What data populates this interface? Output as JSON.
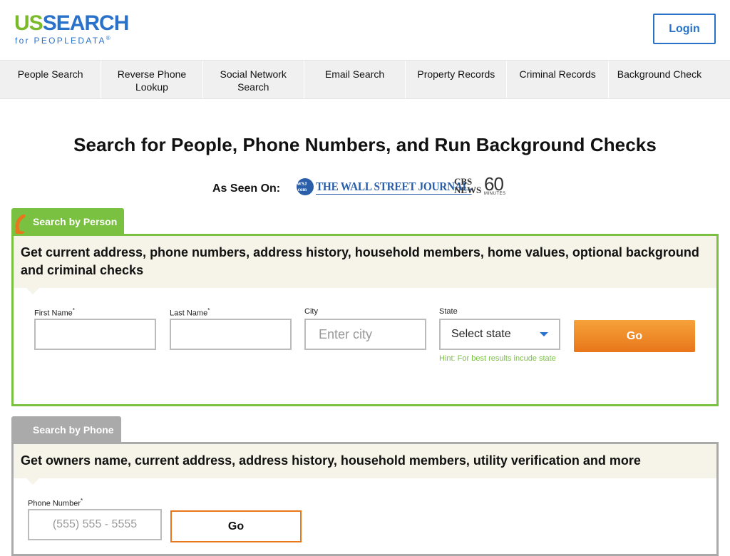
{
  "header": {
    "logo_us": "US",
    "logo_search": "SEARCH",
    "logo_sub": "for PEOPLEDATA",
    "logo_reg": "®",
    "login_label": "Login"
  },
  "nav": {
    "items": [
      {
        "label": "People Search"
      },
      {
        "label": "Reverse Phone Lookup"
      },
      {
        "label": "Social Network Search"
      },
      {
        "label": "Email Search"
      },
      {
        "label": "Property Records"
      },
      {
        "label": "Criminal Records"
      },
      {
        "label": "Background Check"
      }
    ]
  },
  "headline": "Search for People, Phone Numbers, and Run Background Checks",
  "as_seen_on": {
    "label": "As Seen On:",
    "wsj_badge": "WSJ .com",
    "wsj_text": "THE WALL STREET JOURNAL.",
    "cbs_text": "CBS NEWS",
    "sixty": "60",
    "minutes": "MINUTES"
  },
  "person_search": {
    "tab_label": "Search by Person",
    "description": "Get current address, phone numbers, address history, household members, home values, optional background and criminal checks",
    "first_name_label": "First Name",
    "last_name_label": "Last Name",
    "city_label": "City",
    "city_placeholder": "Enter city",
    "state_label": "State",
    "state_selected": "Select state",
    "required_mark": "*",
    "hint": "Hint: For best results incude state",
    "go_label": "Go"
  },
  "phone_search": {
    "tab_label": "Search by Phone",
    "description": "Get owners name, current address, address history, household members, utility verification and more",
    "phone_label": "Phone Number",
    "required_mark": "*",
    "phone_placeholder": "(555) 555 - 5555",
    "go_label": "Go"
  },
  "colors": {
    "brand_green": "#7ac142",
    "brand_blue": "#2a72c9",
    "go_orange": "#e8761a",
    "tab_gray": "#aaaaaa"
  }
}
